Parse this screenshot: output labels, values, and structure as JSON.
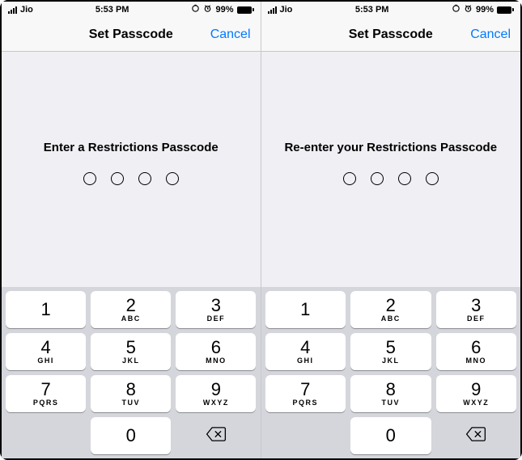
{
  "screens": [
    {
      "status": {
        "carrier": "Jio",
        "time": "5:53 PM",
        "battery_pct": "99%"
      },
      "nav": {
        "title": "Set Passcode",
        "cancel": "Cancel"
      },
      "prompt": "Enter a Restrictions Passcode",
      "dots": 4
    },
    {
      "status": {
        "carrier": "Jio",
        "time": "5:53 PM",
        "battery_pct": "99%"
      },
      "nav": {
        "title": "Set Passcode",
        "cancel": "Cancel"
      },
      "prompt": "Re-enter your Restrictions Passcode",
      "dots": 4
    }
  ],
  "keypad": [
    {
      "digit": "1",
      "letters": ""
    },
    {
      "digit": "2",
      "letters": "ABC"
    },
    {
      "digit": "3",
      "letters": "DEF"
    },
    {
      "digit": "4",
      "letters": "GHI"
    },
    {
      "digit": "5",
      "letters": "JKL"
    },
    {
      "digit": "6",
      "letters": "MNO"
    },
    {
      "digit": "7",
      "letters": "PQRS"
    },
    {
      "digit": "8",
      "letters": "TUV"
    },
    {
      "digit": "9",
      "letters": "WXYZ"
    },
    {
      "digit": "0",
      "letters": ""
    }
  ],
  "icons": {
    "delete": "delete-left-icon",
    "alarm": "alarm-icon",
    "lock": "orientation-lock-icon"
  }
}
